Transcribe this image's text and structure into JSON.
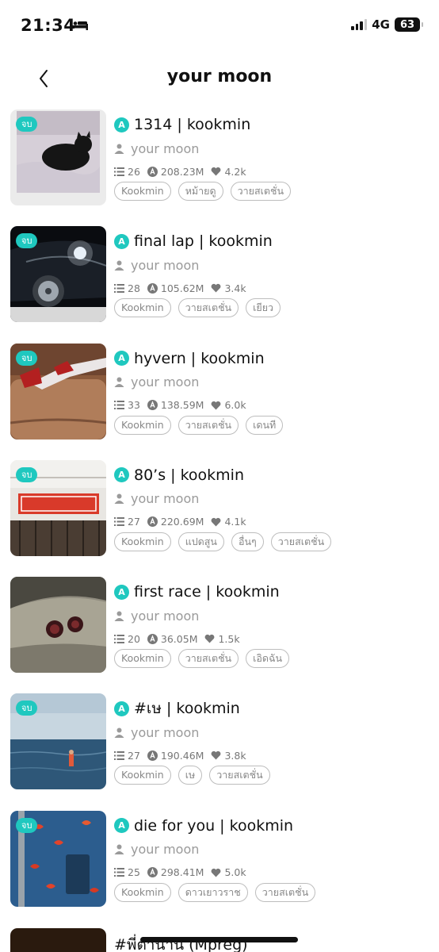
{
  "status_bar": {
    "time": "21:34",
    "network": "4G",
    "battery": "63"
  },
  "header": {
    "title": "your moon"
  },
  "labels": {
    "done": "จบ",
    "author_badge": "A"
  },
  "colors": {
    "accent": "#1fc8bf",
    "tag_border": "#bdbdbd"
  },
  "stories": [
    {
      "title": "1314 | kookmin",
      "author": "your moon",
      "chapters": "26",
      "views": "208.23M",
      "likes": "4.2k",
      "completed": true,
      "tags": [
        "Kookmin",
        "หม้ายดู",
        "วายสเตชั่น"
      ]
    },
    {
      "title": "final lap | kookmin",
      "author": "your moon",
      "chapters": "28",
      "views": "105.62M",
      "likes": "3.4k",
      "completed": true,
      "tags": [
        "Kookmin",
        "วายสเตชั่น",
        "เยียว"
      ]
    },
    {
      "title": "hyvern | kookmin",
      "author": "your moon",
      "chapters": "33",
      "views": "138.59M",
      "likes": "6.0k",
      "completed": true,
      "tags": [
        "Kookmin",
        "วายสเตชั่น",
        "เดนที"
      ]
    },
    {
      "title": "80’s | kookmin",
      "author": "your moon",
      "chapters": "27",
      "views": "220.69M",
      "likes": "4.1k",
      "completed": true,
      "tags": [
        "Kookmin",
        "แปดสูน",
        "อื่นๆ",
        "วายสเตชั่น"
      ]
    },
    {
      "title": "first race | kookmin",
      "author": "your moon",
      "chapters": "20",
      "views": "36.05M",
      "likes": "1.5k",
      "completed": false,
      "tags": [
        "Kookmin",
        "วายสเตชั่น",
        "เอิดฉัน"
      ]
    },
    {
      "title": "#เษ | kookmin",
      "author": "your moon",
      "chapters": "27",
      "views": "190.46M",
      "likes": "3.8k",
      "completed": true,
      "tags": [
        "Kookmin",
        "เษ",
        "วายสเตชั่น"
      ]
    },
    {
      "title": "die for you | kookmin",
      "author": "your moon",
      "chapters": "25",
      "views": "298.41M",
      "likes": "5.0k",
      "completed": true,
      "tags": [
        "Kookmin",
        "ดาวเยาวราช",
        "วายสเตชั่น"
      ]
    }
  ],
  "peek_story": {
    "title": "#พี่ตำนาน (Mpreg)"
  }
}
